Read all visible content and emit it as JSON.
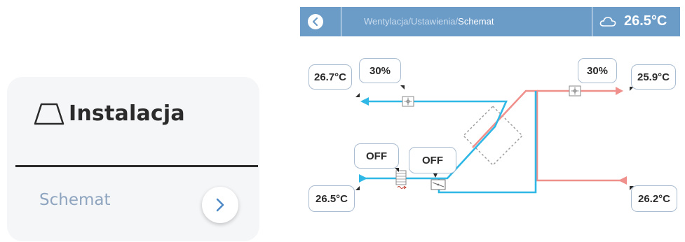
{
  "left_panel": {
    "title": "Instalacja",
    "title_icon": "house-outline-icon",
    "link_label": "Schemat",
    "link_icon": "chevron-right-icon"
  },
  "top_bar": {
    "back_icon": "back-arrow-icon",
    "breadcrumb": {
      "path": "Wentylacja/Ustawienia/",
      "current": "Schemat"
    },
    "weather_icon": "cloud-icon",
    "outdoor_temp": "26.5°C",
    "color": "#6b9bc7"
  },
  "diagram": {
    "supply_temp": "26.7°C",
    "supply_fan": "30%",
    "exhaust_fan": "30%",
    "exhaust_temp": "25.9°C",
    "filter_status": "OFF",
    "bypass_status": "OFF",
    "outdoor_temp": "26.5°C",
    "extract_temp": "26.2°C",
    "fan_icon": "fan-icon",
    "filter_icon": "filter-heater-icon",
    "bypass_icon": "bypass-damper-icon",
    "heat_exchanger_icon": "heat-exchanger-icon",
    "colors": {
      "cold": "#2fb8e6",
      "warm": "#f0908c",
      "box_border": "#aabcd0"
    }
  }
}
